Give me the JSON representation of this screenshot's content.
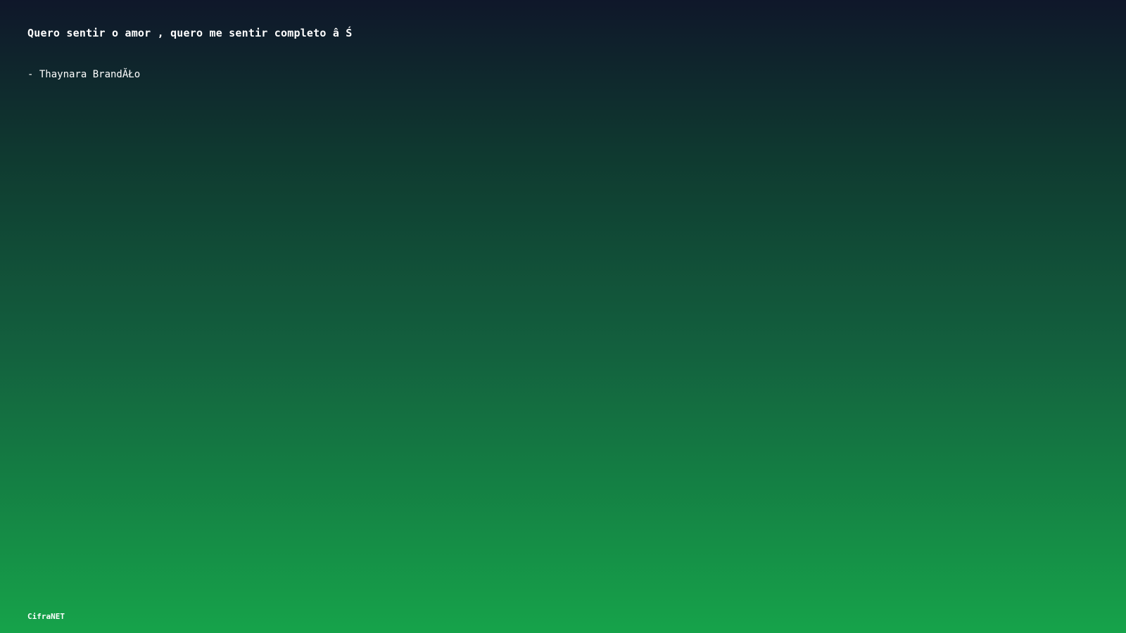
{
  "quote": {
    "text": "Quero sentir o amor , quero me sentir completo â Ś",
    "author": "- Thaynara BrandĂŁo"
  },
  "footer": {
    "brand": "CifraNET"
  },
  "colors": {
    "gradient_top": "#0f172a",
    "gradient_bottom": "#16a34a",
    "text": "#ffffff"
  }
}
